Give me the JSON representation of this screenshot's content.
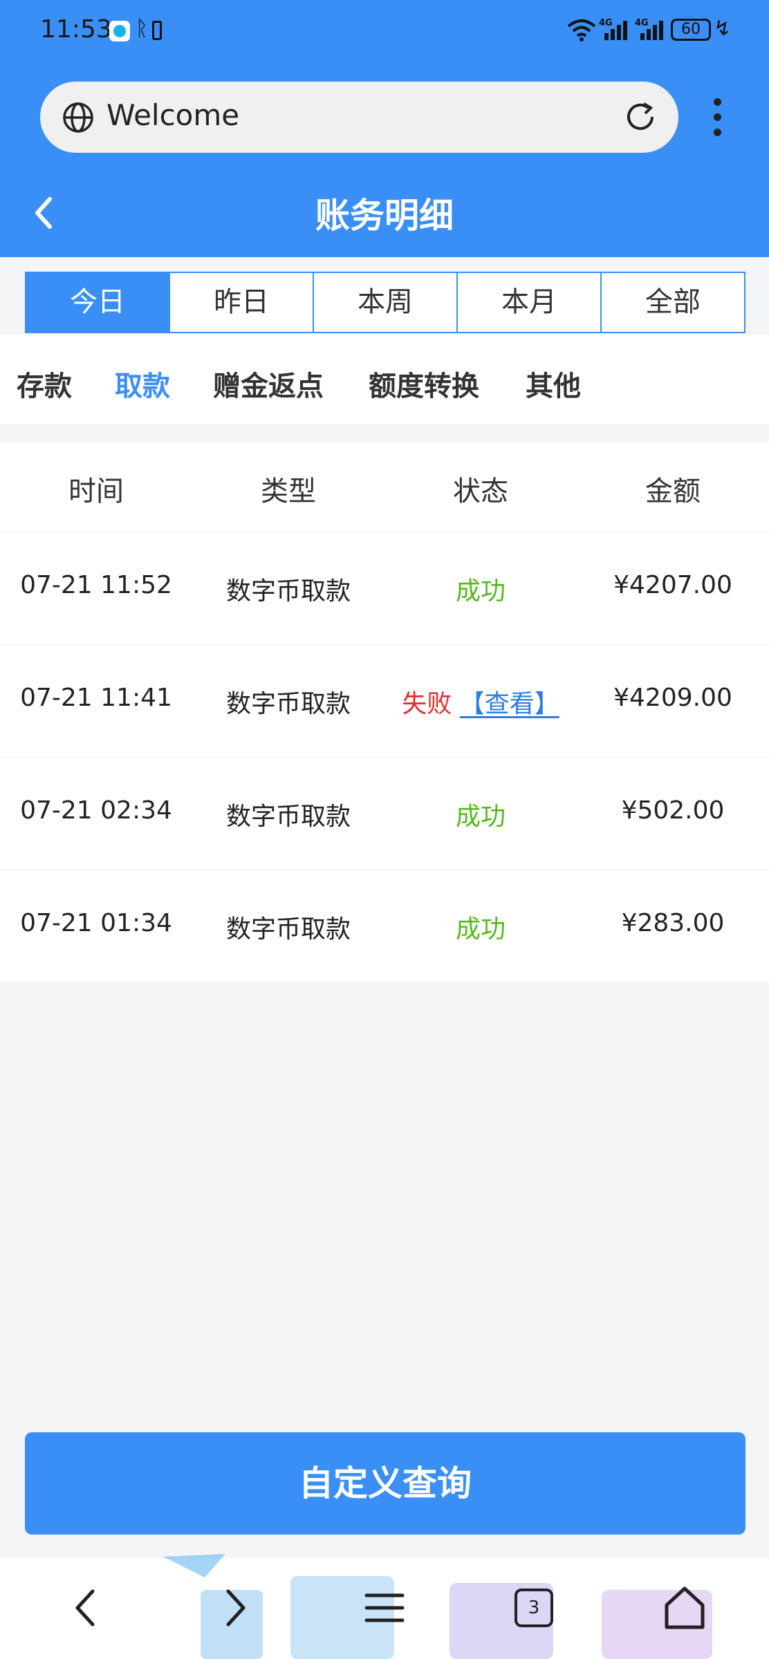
{
  "status_bar": {
    "time": "11:53",
    "battery": "60"
  },
  "browser": {
    "url_text": "Welcome"
  },
  "header": {
    "title": "账务明细"
  },
  "period_tabs": [
    {
      "label": "今日",
      "active": true
    },
    {
      "label": "昨日",
      "active": false
    },
    {
      "label": "本周",
      "active": false
    },
    {
      "label": "本月",
      "active": false
    },
    {
      "label": "全部",
      "active": false
    }
  ],
  "categories": [
    {
      "label": "存款",
      "active": false
    },
    {
      "label": "取款",
      "active": true
    },
    {
      "label": "赠金返点",
      "active": false
    },
    {
      "label": "额度转换",
      "active": false
    },
    {
      "label": "其他",
      "active": false
    }
  ],
  "table": {
    "columns": [
      "时间",
      "类型",
      "状态",
      "金额"
    ],
    "rows": [
      {
        "time": "07-21 11:52",
        "type": "数字币取款",
        "status": "成功",
        "amount": "¥4207.00"
      },
      {
        "time": "07-21 11:41",
        "type": "数字币取款",
        "status": "失败",
        "link": "【查看】",
        "amount": "¥4209.00"
      },
      {
        "time": "07-21 02:34",
        "type": "数字币取款",
        "status": "成功",
        "amount": "¥502.00"
      },
      {
        "time": "07-21 01:34",
        "type": "数字币取款",
        "status": "成功",
        "amount": "¥283.00"
      }
    ]
  },
  "actions": {
    "custom_query": "自定义查询"
  },
  "bottom_nav": {
    "tab_count": "3"
  },
  "colors": {
    "accent": "#3a8ff6",
    "success": "#52b91c",
    "failure": "#e52d2d",
    "link": "#2c7de0"
  },
  "icons": [
    "globe-icon",
    "reload-icon",
    "more-icon",
    "back-icon",
    "nav-back-icon",
    "nav-forward-icon",
    "nav-menu-icon",
    "tabs-icon",
    "home-icon"
  ]
}
